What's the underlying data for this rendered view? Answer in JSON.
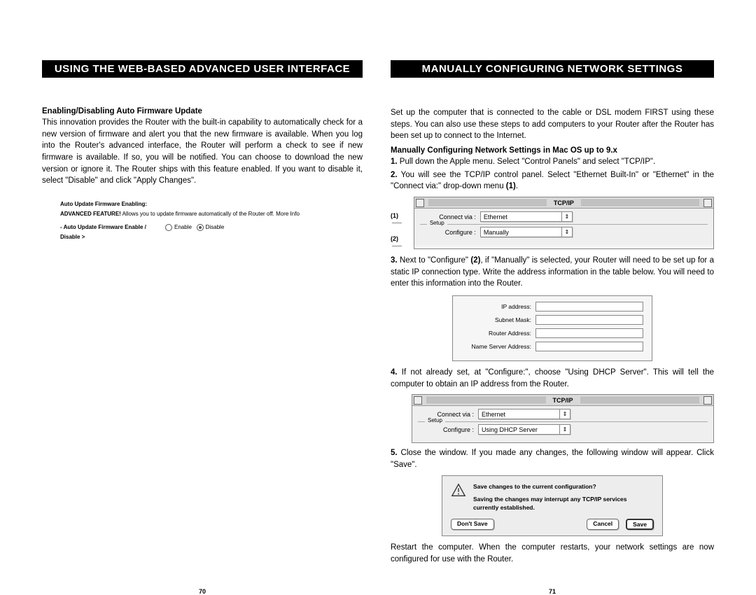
{
  "left": {
    "header": "USING THE WEB-BASED ADVANCED USER INTERFACE",
    "heading": "Enabling/Disabling Auto Firmware Update",
    "paragraph": "This innovation provides the Router with the built-in capability to automatically check for a new version of firmware and alert you that the new firmware is available. When you log into the Router's advanced interface, the Router will perform a check to see if new firmware is available. If so, you will be notified. You can choose to download the new version or ignore it. The Router ships with this feature enabled. If you want to disable it, select \"Disable\" and click \"Apply Changes\".",
    "firmware": {
      "title": "Auto Update Firmware Enabling:",
      "feature_label": "ADVANCED FEATURE!",
      "feature_text": " Allows you to update firmware automatically of the Router off. More Info",
      "enable_label": "- Auto Update Firmware Enable / Disable >",
      "opt_enable": "Enable",
      "opt_disable": "Disable"
    },
    "page_num": "70"
  },
  "right": {
    "header": "MANUALLY CONFIGURING NETWORK SETTINGS",
    "intro": "Set up the computer that is connected to the cable or DSL modem FIRST using these steps. You can also use these steps to add computers to your Router after the Router has been set up to connect to the Internet.",
    "subheading": "Manually Configuring Network Settings in Mac OS up to 9.x",
    "step1_num": "1.",
    "step1": " Pull down the Apple menu. Select \"Control Panels\" and select \"TCP/IP\".",
    "step2_num": "2.",
    "step2a": " You will see the TCP/IP control panel. Select \"Ethernet Built-In\" or \"Ethernet\" in the \"Connect via:\" drop-down menu ",
    "step2b": "(1)",
    "step2c": ".",
    "callout1": "(1)",
    "callout2": "(2)",
    "tcpip": {
      "title": "TCP/IP",
      "connect_label": "Connect via :",
      "connect_value": "Ethernet",
      "setup_label": "Setup",
      "configure_label": "Configure :",
      "configure_value1": "Manually",
      "configure_value2": "Using DHCP Server"
    },
    "step3_num": "3.",
    "step3a": " Next to \"Configure\" ",
    "step3b": "(2)",
    "step3c": ", if \"Manually\" is selected, your Router will need to be set up for a static IP connection type. Write the address information in the table below. You will need to enter this information into the Router.",
    "ip_labels": {
      "ip": "IP address:",
      "subnet": "Subnet Mask:",
      "router": "Router Address:",
      "ns": "Name Server Address:"
    },
    "step4_num": "4.",
    "step4": " If not already set, at \"Configure:\", choose \"Using DHCP Server\". This will tell the computer to obtain an IP address from the Router.",
    "step5_num": "5.",
    "step5": " Close the window. If you made any changes, the following window will appear. Click \"Save\".",
    "save_dialog": {
      "question": "Save changes to the current configuration?",
      "warn": "Saving the changes may interrupt any TCP/IP services currently established.",
      "dont_save": "Don't Save",
      "cancel": "Cancel",
      "save": "Save"
    },
    "outro": "Restart the computer. When the computer restarts, your network settings are now configured for use with the Router.",
    "page_num": "71"
  }
}
